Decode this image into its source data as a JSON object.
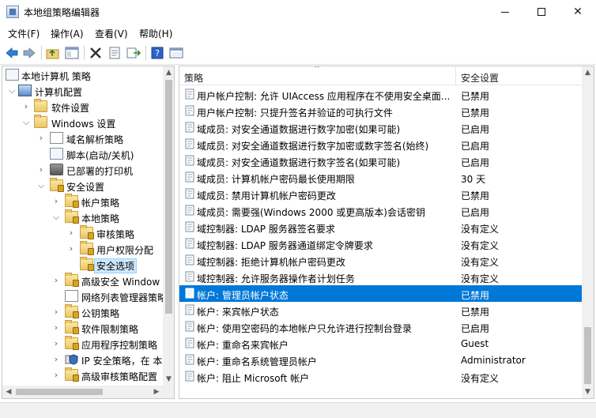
{
  "window": {
    "title": "本地组策略编辑器",
    "minimize_glyph": "—",
    "maximize_glyph": "☐",
    "close_glyph": "✕"
  },
  "menu": [
    "文件(F)",
    "操作(A)",
    "查看(V)",
    "帮助(H)"
  ],
  "toolbar": {
    "icons": [
      "back-arrow-icon",
      "forward-arrow-icon",
      "up-folder-icon",
      "show-hide-tree-icon",
      "delete-icon",
      "properties-icon",
      "export-list-icon",
      "help-icon",
      "console-icon"
    ]
  },
  "tree": {
    "items": [
      {
        "label": "本地计算机 策略",
        "level": 0,
        "expander": "",
        "icon": "doc"
      },
      {
        "label": "计算机配置",
        "level": 1,
        "expander": "v",
        "icon": "computer"
      },
      {
        "label": "软件设置",
        "level": 2,
        "expander": ">",
        "icon": "folder"
      },
      {
        "label": "Windows 设置",
        "level": 2,
        "expander": "v",
        "icon": "folder"
      },
      {
        "label": "域名解析策略",
        "level": 3,
        "expander": ">",
        "icon": "sheet"
      },
      {
        "label": "脚本(启动/关机)",
        "level": 3,
        "expander": "",
        "icon": "doc"
      },
      {
        "label": "已部署的打印机",
        "level": 3,
        "expander": ">",
        "icon": "printer"
      },
      {
        "label": "安全设置",
        "level": 3,
        "expander": "v",
        "icon": "lockfolder"
      },
      {
        "label": "帐户策略",
        "level": 4,
        "expander": ">",
        "icon": "lockfolder"
      },
      {
        "label": "本地策略",
        "level": 4,
        "expander": "v",
        "icon": "lockfolder"
      },
      {
        "label": "审核策略",
        "level": 5,
        "expander": ">",
        "icon": "lockfolder"
      },
      {
        "label": "用户权限分配",
        "level": 5,
        "expander": ">",
        "icon": "lockfolder"
      },
      {
        "label": "安全选项",
        "level": 5,
        "expander": "",
        "icon": "lockfolder",
        "selected": true
      },
      {
        "label": "高级安全 Window",
        "level": 4,
        "expander": ">",
        "icon": "lockfolder"
      },
      {
        "label": "网络列表管理器策略",
        "level": 4,
        "expander": "",
        "icon": "sheet"
      },
      {
        "label": "公钥策略",
        "level": 4,
        "expander": ">",
        "icon": "lockfolder"
      },
      {
        "label": "软件限制策略",
        "level": 4,
        "expander": ">",
        "icon": "lockfolder"
      },
      {
        "label": "应用程序控制策略",
        "level": 4,
        "expander": ">",
        "icon": "lockfolder"
      },
      {
        "label": "IP 安全策略，在 本",
        "level": 4,
        "expander": ">",
        "icon": "shield"
      },
      {
        "label": "高级审核策略配置",
        "level": 4,
        "expander": ">",
        "icon": "lockfolder"
      }
    ]
  },
  "list": {
    "columns": [
      "策略",
      "安全设置"
    ],
    "sort_caret": "^",
    "rows": [
      {
        "policy": "用户帐户控制: 允许 UIAccess 应用程序在不使用安全桌面...",
        "setting": "已禁用"
      },
      {
        "policy": "用户帐户控制: 只提升签名并验证的可执行文件",
        "setting": "已禁用"
      },
      {
        "policy": "域成员: 对安全通道数据进行数字加密(如果可能)",
        "setting": "已启用"
      },
      {
        "policy": "域成员: 对安全通道数据进行数字加密或数字签名(始终)",
        "setting": "已启用"
      },
      {
        "policy": "域成员: 对安全通道数据进行数字签名(如果可能)",
        "setting": "已启用"
      },
      {
        "policy": "域成员: 计算机帐户密码最长使用期限",
        "setting": "30 天"
      },
      {
        "policy": "域成员: 禁用计算机帐户密码更改",
        "setting": "已禁用"
      },
      {
        "policy": "域成员: 需要强(Windows 2000 或更高版本)会话密钥",
        "setting": "已启用"
      },
      {
        "policy": "域控制器: LDAP 服务器签名要求",
        "setting": "没有定义"
      },
      {
        "policy": "域控制器: LDAP 服务器通道绑定令牌要求",
        "setting": "没有定义"
      },
      {
        "policy": "域控制器: 拒绝计算机帐户密码更改",
        "setting": "没有定义"
      },
      {
        "policy": "域控制器: 允许服务器操作者计划任务",
        "setting": "没有定义"
      },
      {
        "policy": "帐户: 管理员帐户状态",
        "setting": "已禁用",
        "selected": true
      },
      {
        "policy": "帐户: 来宾帐户状态",
        "setting": "已禁用"
      },
      {
        "policy": "帐户: 使用空密码的本地帐户只允许进行控制台登录",
        "setting": "已启用"
      },
      {
        "policy": "帐户: 重命名来宾帐户",
        "setting": "Guest"
      },
      {
        "policy": "帐户: 重命名系统管理员帐户",
        "setting": "Administrator"
      },
      {
        "policy": "帐户: 阻止 Microsoft 帐户",
        "setting": "没有定义"
      }
    ]
  },
  "colors": {
    "selection": "#0078d7",
    "tree_selection": "#cce8ff"
  }
}
